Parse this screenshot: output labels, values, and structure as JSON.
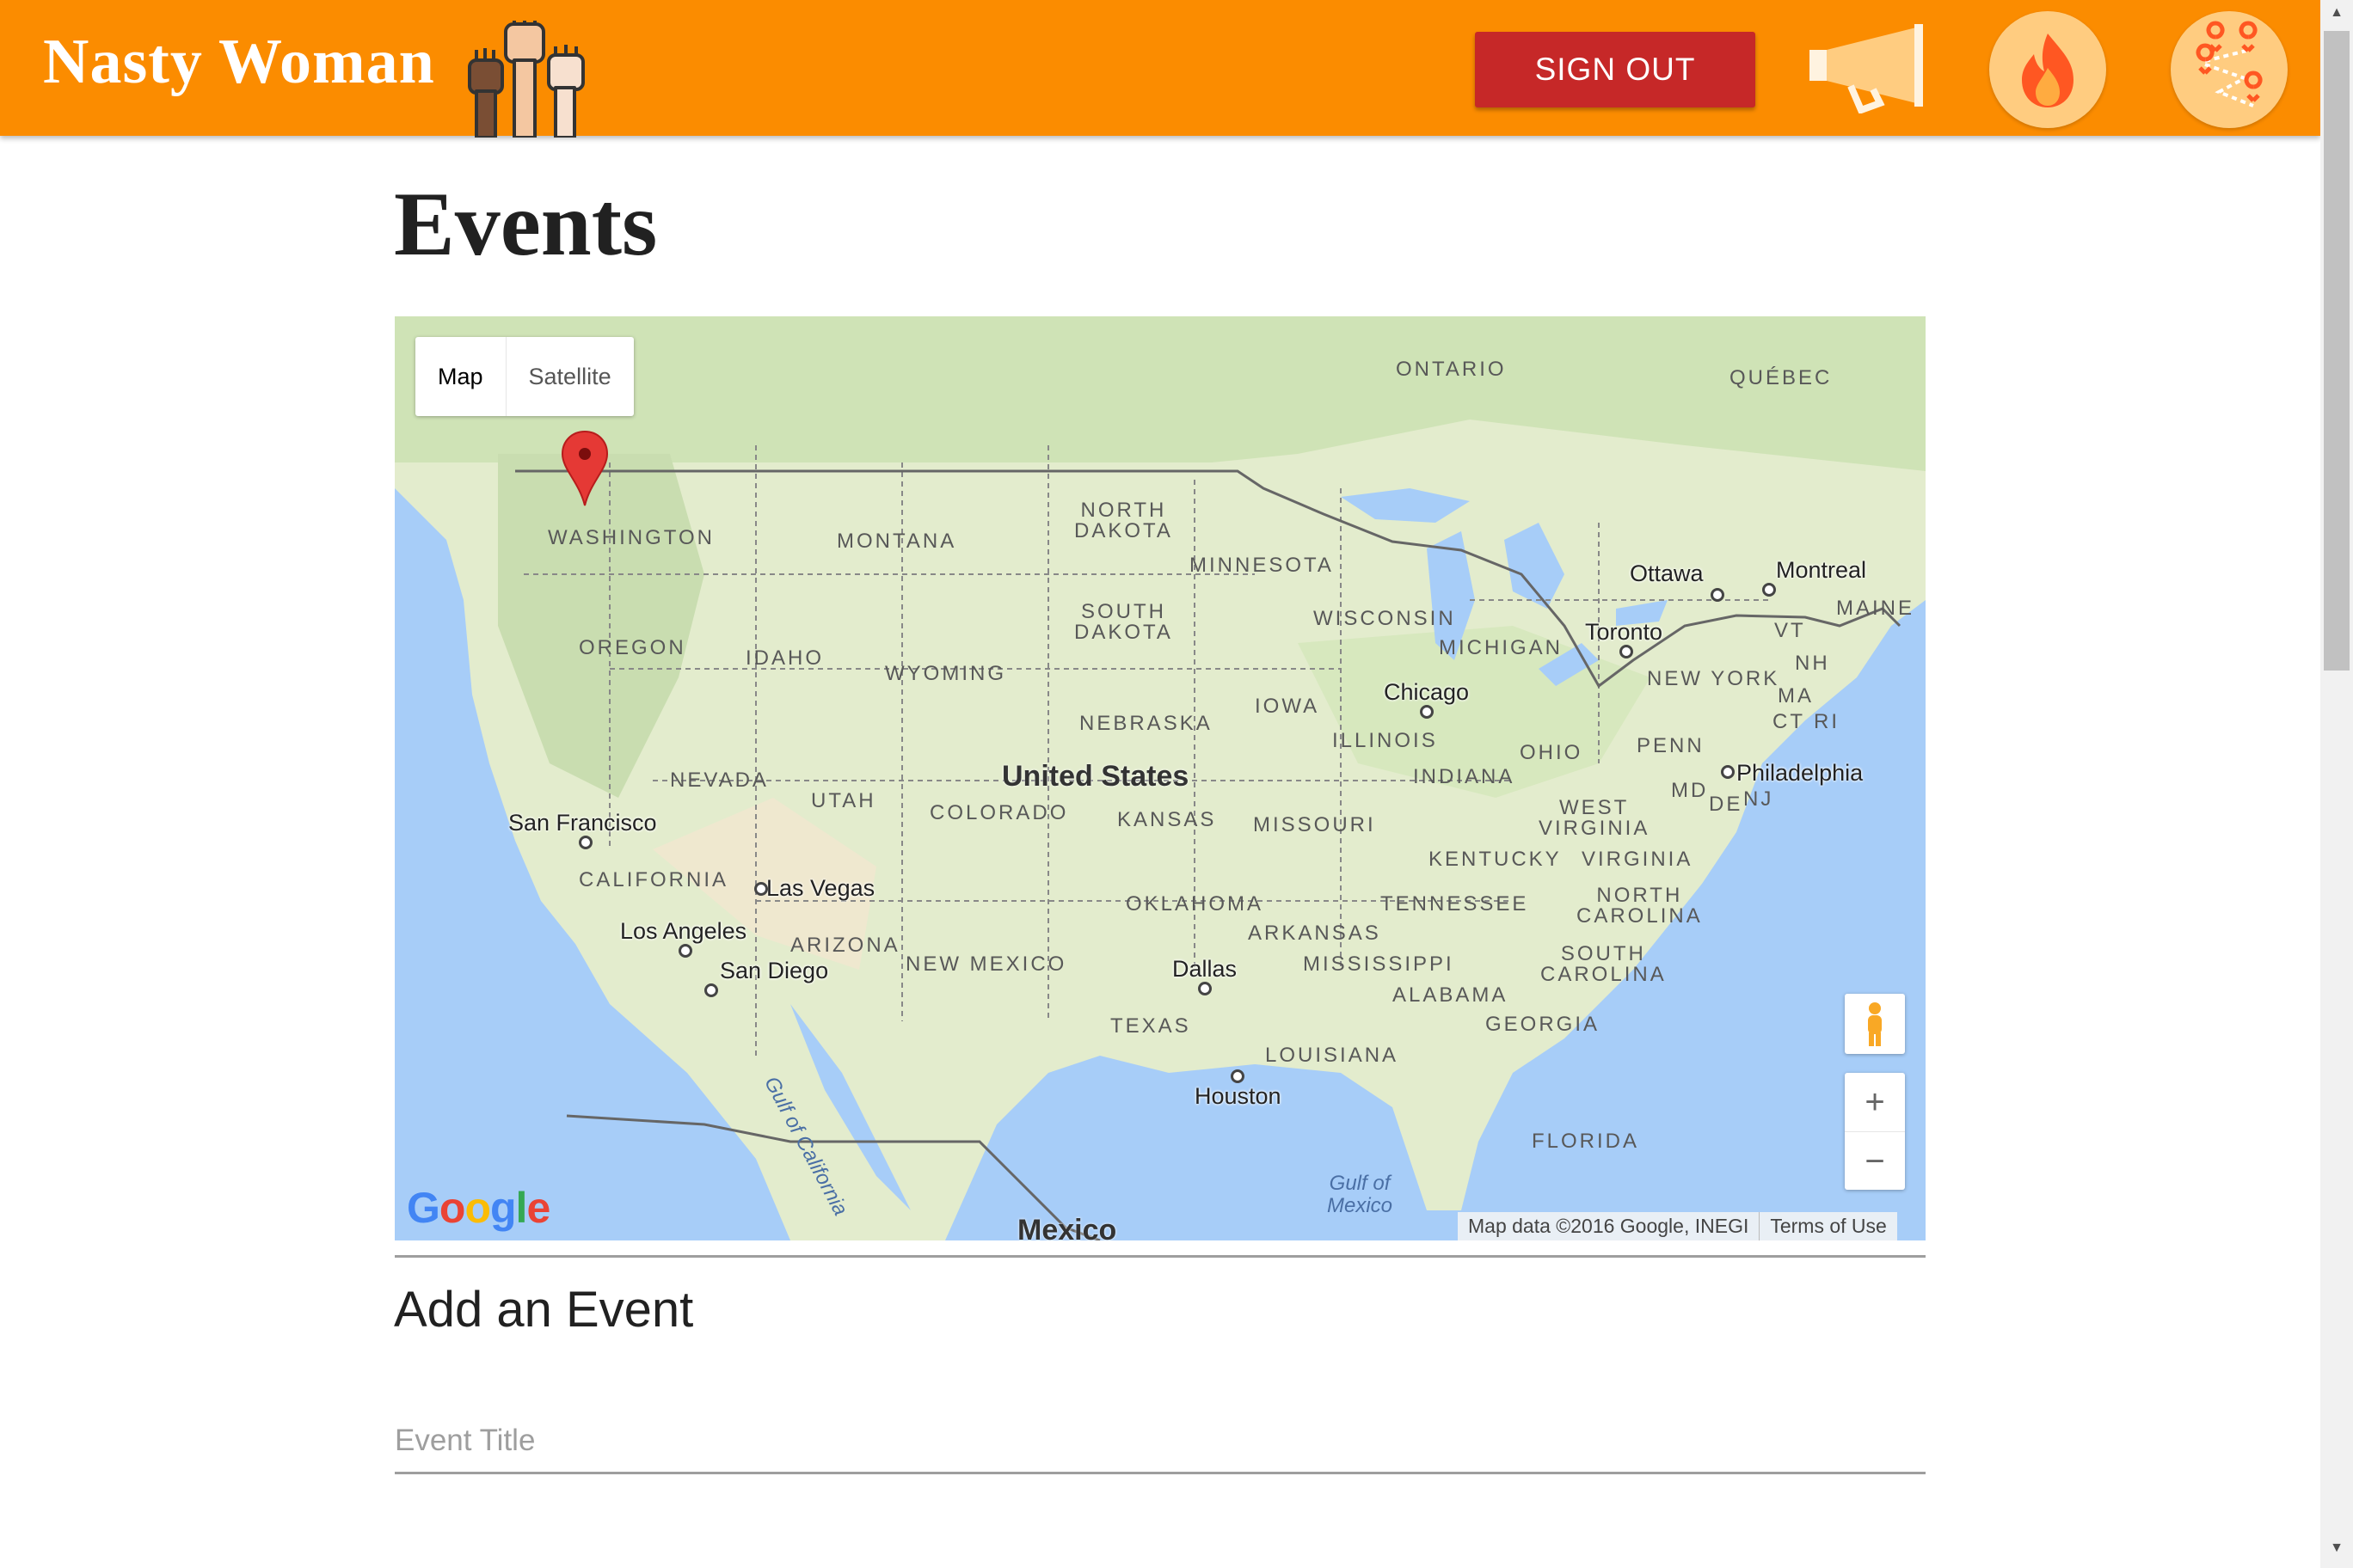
{
  "header": {
    "brand": "Nasty Woman",
    "sign_out_label": "SIGN OUT",
    "brand_color": "#fb8c00",
    "signout_color": "#c62828",
    "icons": [
      "raised-fists-icon",
      "megaphone-icon",
      "fire-icon",
      "map-pins-icon"
    ]
  },
  "page": {
    "title": "Events"
  },
  "map": {
    "type_controls": {
      "map": "Map",
      "satellite": "Satellite"
    },
    "labels": {
      "ontario": "ONTARIO",
      "quebec": "QUÉBEC",
      "washington": "WASHINGTON",
      "montana": "MONTANA",
      "north_dakota": "NORTH\nDAKOTA",
      "minnesota": "MINNESOTA",
      "south_dakota": "SOUTH\nDAKOTA",
      "wisconsin": "WISCONSIN",
      "michigan": "MICHIGAN",
      "oregon": "OREGON",
      "idaho": "IDAHO",
      "wyoming": "WYOMING",
      "iowa": "IOWA",
      "nebraska": "NEBRASKA",
      "illinois": "ILLINOIS",
      "ohio": "OHIO",
      "penn": "PENN",
      "nevada": "NEVADA",
      "utah": "UTAH",
      "colorado": "COLORADO",
      "kansas": "KANSAS",
      "missouri": "MISSOURI",
      "indiana": "INDIANA",
      "west_virginia": "WEST\nVIRGINIA",
      "kentucky": "KENTUCKY",
      "virginia": "VIRGINIA",
      "california": "CALIFORNIA",
      "oklahoma": "OKLAHOMA",
      "tennessee": "TENNESSEE",
      "north_carolina": "NORTH\nCAROLINA",
      "arizona": "ARIZONA",
      "new_mexico": "NEW MEXICO",
      "arkansas": "ARKANSAS",
      "mississippi": "MISSISSIPPI",
      "alabama": "ALABAMA",
      "south_carolina": "SOUTH\nCAROLINA",
      "georgia": "GEORGIA",
      "texas": "TEXAS",
      "louisiana": "LOUISIANA",
      "florida": "FLORIDA",
      "maine": "MAINE",
      "vt": "VT",
      "nh": "NH",
      "ma": "MA",
      "ct": "CT",
      "ri": "RI",
      "new_york": "NEW YORK",
      "md": "MD",
      "de": "DE",
      "nj": "NJ"
    },
    "cities": {
      "ottawa": "Ottawa",
      "montreal": "Montreal",
      "toronto": "Toronto",
      "chicago": "Chicago",
      "philadelphia": "Philadelphia",
      "san_francisco": "San Francisco",
      "las_vegas": "Las Vegas",
      "los_angeles": "Los Angeles",
      "san_diego": "San Diego",
      "dallas": "Dallas",
      "houston": "Houston"
    },
    "country": "United States",
    "mexico": "Mexico",
    "water": {
      "gulf_california": "Gulf of California",
      "gulf_mexico": "Gulf of\nMexico"
    },
    "zoom_in": "+",
    "zoom_out": "−",
    "logo": "Google",
    "attribution": "Map data ©2016 Google, INEGI",
    "terms": "Terms of Use"
  },
  "form": {
    "section_title": "Add an Event",
    "event_title_placeholder": "Event Title"
  }
}
